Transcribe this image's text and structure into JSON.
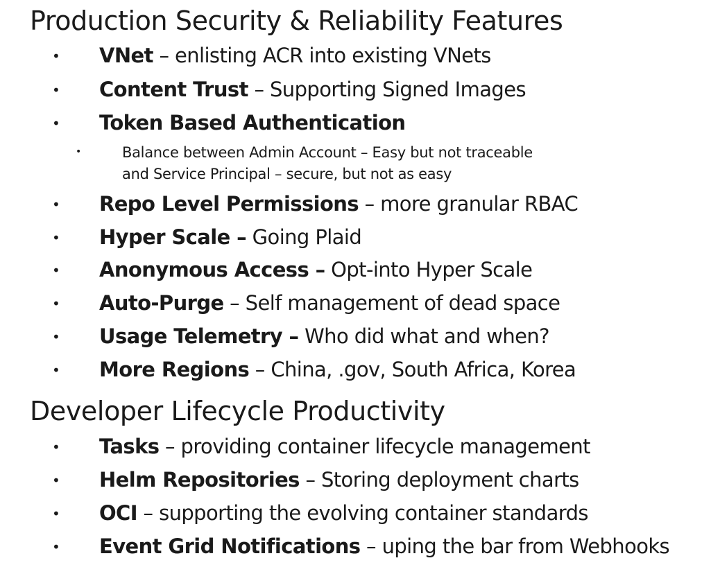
{
  "section1": {
    "heading": "Production Security & Reliability Features",
    "items": [
      {
        "term": "VNet",
        "desc": " – enlisting ACR into existing VNets"
      },
      {
        "term": "Content Trust",
        "desc": " – Supporting Signed Images"
      },
      {
        "term": "Token Based Authentication",
        "desc": ""
      },
      {
        "term": "Repo Level Permissions",
        "desc": " – more granular RBAC"
      },
      {
        "term": "Hyper Scale –",
        "desc": " Going Plaid"
      },
      {
        "term": "Anonymous Access –",
        "desc": " Opt-into Hyper Scale"
      },
      {
        "term": "Auto-Purge",
        "desc": " – Self management of dead space"
      },
      {
        "term": "Usage Telemetry –",
        "desc": " Who did what and when?"
      },
      {
        "term": "More Regions",
        "desc": " – China, .gov, South Africa, Korea"
      }
    ],
    "subitem": {
      "line1": "Balance between Admin Account – Easy but not traceable",
      "line2": "and Service Principal – secure, but not as easy"
    }
  },
  "section2": {
    "heading": "Developer Lifecycle Productivity",
    "items": [
      {
        "term": "Tasks",
        "desc": " – providing container lifecycle management"
      },
      {
        "term": "Helm Repositories",
        "desc": " – Storing deployment charts"
      },
      {
        "term": "OCI",
        "desc": " – supporting the evolving container standards"
      },
      {
        "term": "Event Grid Notifications",
        "desc": " – uping the bar from Webhooks"
      }
    ]
  },
  "bullet_glyph": "•"
}
